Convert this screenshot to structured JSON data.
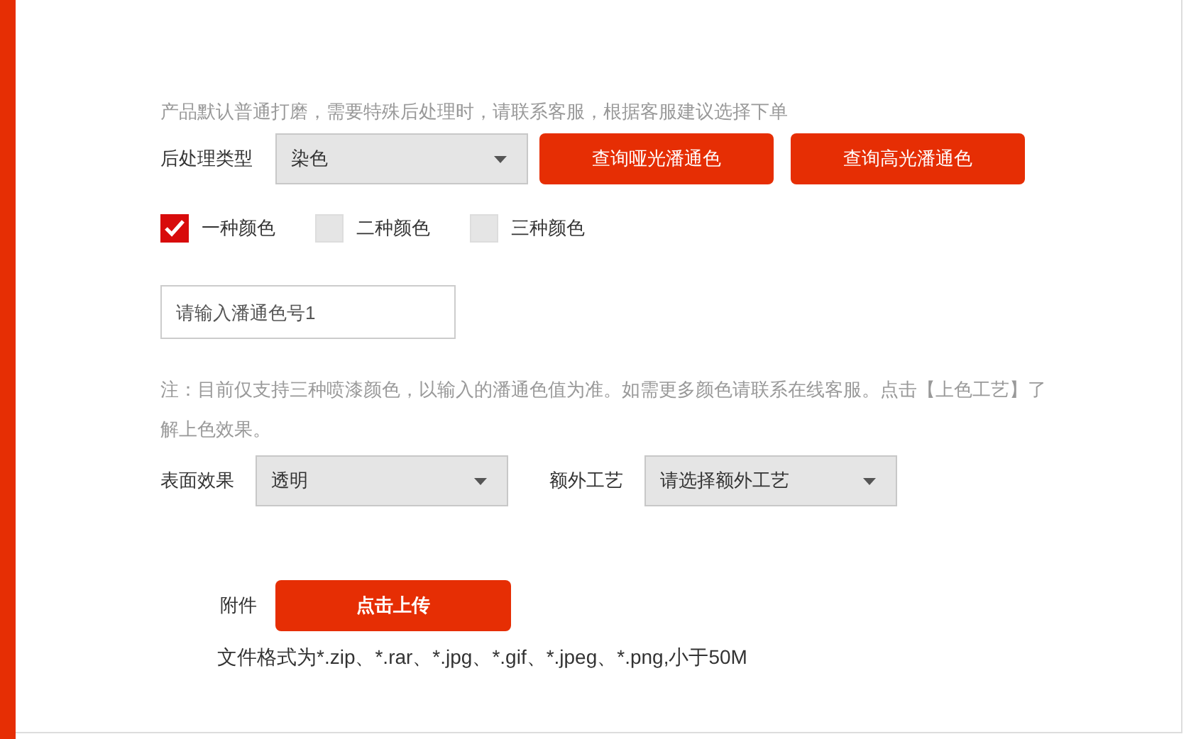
{
  "hint": "产品默认普通打磨，需要特殊后处理时，请联系客服，根据客服建议选择下单",
  "post_process": {
    "label": "后处理类型",
    "value": "染色"
  },
  "buttons": [
    "查询哑光潘通色",
    "查询高光潘通色"
  ],
  "color_options": [
    {
      "label": "一种颜色",
      "checked": true
    },
    {
      "label": "二种颜色",
      "checked": false
    },
    {
      "label": "三种颜色",
      "checked": false
    }
  ],
  "pantone_input": {
    "placeholder": "请输入潘通色号1"
  },
  "note": "注：目前仅支持三种喷漆颜色，以输入的潘通色值为准。如需更多颜色请联系在线客服。点击【上色工艺】了解上色效果。",
  "surface": {
    "label": "表面效果",
    "value": "透明"
  },
  "extra": {
    "label": "额外工艺",
    "value": "请选择额外工艺"
  },
  "attachment": {
    "label": "附件",
    "button": "点击上传",
    "formats": "文件格式为*.zip、*.rar、*.jpg、*.gif、*.jpeg、*.png,小于50M"
  }
}
